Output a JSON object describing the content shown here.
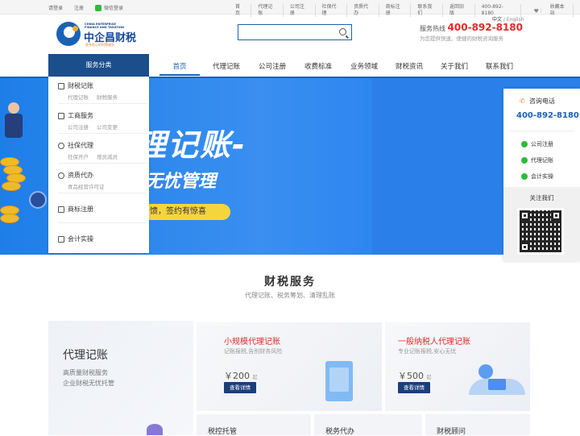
{
  "topbar": {
    "login": "请登录",
    "register": "注册",
    "wechat_login": "微信登录",
    "links": [
      "首页",
      "代理记账",
      "公司注册",
      "社保代理",
      "资质代办",
      "商标注册",
      "联系我们",
      "返回旧版",
      "400-892-8180"
    ],
    "favorite": "收藏本站"
  },
  "lang": {
    "cn": "中文",
    "sep": " / ",
    "en": "English"
  },
  "logo": {
    "en_line1": "CHINA ENTERPRISE",
    "en_line2": "FINANCE AND TAXATION",
    "cn": "中企昌财税",
    "slogan": "更多贴心的财税服务"
  },
  "search": {
    "placeholder": "",
    "icon": "search-icon"
  },
  "hotline": {
    "label": "服务热线 ",
    "number": "400-892-8180",
    "sub": "为您提供快速、便捷的财税咨询服务"
  },
  "category_button": "服务分类",
  "nav": [
    {
      "label": "首页",
      "active": true
    },
    {
      "label": "代理记账",
      "active": false
    },
    {
      "label": "公司注册",
      "active": false
    },
    {
      "label": "收费标准",
      "active": false
    },
    {
      "label": "业务领域",
      "active": false
    },
    {
      "label": "财税资讯",
      "active": false
    },
    {
      "label": "关于我们",
      "active": false
    },
    {
      "label": "联系我们",
      "active": false
    }
  ],
  "banner": {
    "headline": "理记账-",
    "subline": "无忧管理",
    "pill": "馈，签约有惊喜"
  },
  "side_menu": [
    {
      "title": "财税记账",
      "subs": [
        "代理记账",
        "财税服务"
      ],
      "icon": "document-icon"
    },
    {
      "title": "工商服务",
      "subs": [
        "公司注册",
        "公司变更"
      ],
      "icon": "briefcase-icon"
    },
    {
      "title": "社保代理",
      "subs": [
        "社保开户",
        "增员减员"
      ],
      "icon": "user-icon"
    },
    {
      "title": "资质代办",
      "subs": [
        "食品经营许可证"
      ],
      "icon": "globe-icon"
    },
    {
      "title": "商标注册",
      "subs": [],
      "icon": "trademark-icon"
    },
    {
      "title": "会计实操",
      "subs": [],
      "icon": "pen-icon"
    }
  ],
  "consult": {
    "title": "咨询电话",
    "phone": "400-892-8180",
    "items": [
      "公司注册",
      "代理记账",
      "会计实操"
    ],
    "follow": "关注我们"
  },
  "section": {
    "title": "财税服务",
    "subtitle": "代理记账、税务筹划、清理乱账"
  },
  "main_card": {
    "title": "代理记账",
    "desc1": "高质量财税服务",
    "desc2": "企业财税无忧托管"
  },
  "cards": [
    {
      "title": "小规模代理记账",
      "desc": "记账报税,告别财务风险",
      "price": "￥200",
      "unit": "起",
      "button": "查看详情"
    },
    {
      "title": "一般纳税人代理记账",
      "desc": "专业记账报税,安心无忧",
      "price": "￥500",
      "unit": "起",
      "button": "查看详情"
    }
  ],
  "bottom_cards": [
    "税控托管",
    "税务代办",
    "财税顾问"
  ],
  "colors": {
    "primary": "#1a62b5",
    "navy": "#1a4f8b",
    "red": "#e02b2b",
    "banner": "#2d86f0"
  }
}
